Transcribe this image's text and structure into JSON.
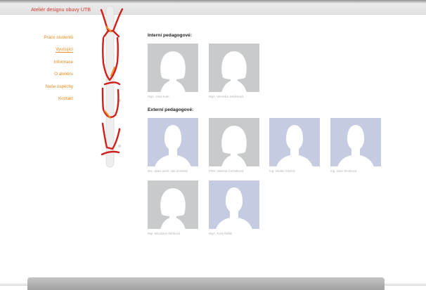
{
  "header": {
    "brand": "Ateliér designu obuvy UTB"
  },
  "nav": [
    {
      "label": "Práce studentů",
      "active": false
    },
    {
      "label": "Vyučující",
      "active": true
    },
    {
      "label": "Informace",
      "active": false
    },
    {
      "label": "O ateliéru",
      "active": false
    },
    {
      "label": "Naše úspěchy",
      "active": false
    },
    {
      "label": "Kontakt",
      "active": false
    }
  ],
  "sections": {
    "internal": {
      "heading": "Interní pedagogové:",
      "people": [
        {
          "name": "MgA. Jana Kurk",
          "silhouette": "female"
        },
        {
          "name": "MgA. Veronika Jakóbková",
          "silhouette": "female"
        }
      ]
    },
    "external": {
      "heading": "Externí pedagogové:",
      "people": [
        {
          "name": "doc. akad. soch. Jan Zemanel",
          "silhouette": "male"
        },
        {
          "name": "PhDr. Martina Čermáková",
          "silhouette": "female"
        },
        {
          "name": "Ing. Václav Glinček",
          "silhouette": "male"
        },
        {
          "name": "Ing. Jana Teneková",
          "silhouette": "male"
        },
        {
          "name": "Mgr. Miroslava Štěrbová",
          "silhouette": "female"
        },
        {
          "name": "MgA. Juraj Šidlák",
          "silhouette": "male"
        }
      ]
    }
  },
  "colors": {
    "brand": "#d63a2e",
    "nav": "#f08a1c",
    "female_photo_bg": "#c9cacc",
    "male_photo_bg": "#c5cce1"
  }
}
